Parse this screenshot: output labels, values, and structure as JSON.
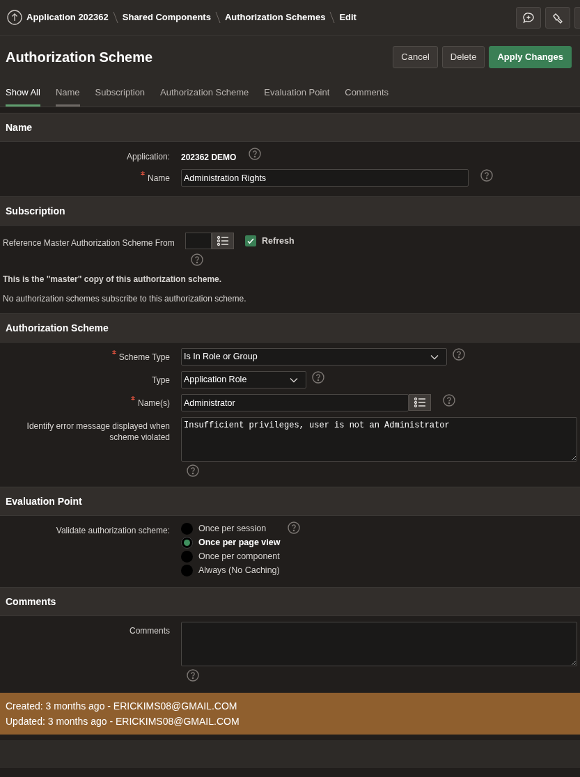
{
  "breadcrumbs": [
    "Application 202362",
    "Shared Components",
    "Authorization Schemes",
    "Edit"
  ],
  "title": "Authorization Scheme",
  "buttons": [
    {
      "label": "Cancel",
      "kind": "default"
    },
    {
      "label": "Delete",
      "kind": "default"
    },
    {
      "label": "Apply Changes",
      "kind": "primary"
    }
  ],
  "tabs": [
    {
      "label": "Show All",
      "selected": true,
      "hovered": false
    },
    {
      "label": "Name",
      "selected": false,
      "hovered": true
    },
    {
      "label": "Subscription",
      "selected": false,
      "hovered": false
    },
    {
      "label": "Authorization Scheme",
      "selected": false,
      "hovered": false
    },
    {
      "label": "Evaluation Point",
      "selected": false,
      "hovered": false
    },
    {
      "label": "Comments",
      "selected": false,
      "hovered": false
    }
  ],
  "sections": [
    {
      "title": "Name",
      "rows": [
        {
          "kind": "display",
          "label": "Application:",
          "value": "202362 DEMO",
          "required": false,
          "help": true
        },
        {
          "kind": "text",
          "label": "Name",
          "value": "Administration Rights",
          "required": true,
          "help": true
        }
      ]
    },
    {
      "title": "Subscription",
      "rows": [
        {
          "kind": "subscription",
          "label": "Reference Master Authorization Scheme From",
          "checkbox": {
            "label": "Refresh",
            "checked": true
          },
          "help": true
        },
        {
          "kind": "note",
          "text": "This is the \"master\" copy of this authorization scheme.",
          "bold": true
        },
        {
          "kind": "note",
          "text": "No authorization schemes subscribe to this authorization scheme.",
          "bold": false
        }
      ]
    },
    {
      "title": "Authorization Scheme",
      "rows": [
        {
          "kind": "select",
          "label": "Scheme Type",
          "value": "Is In Role or Group",
          "required": true,
          "help": true
        },
        {
          "kind": "select",
          "label": "Type",
          "value": "Application Role",
          "required": false,
          "help": true
        },
        {
          "kind": "lov",
          "label": "Name(s)",
          "value": "Administrator",
          "required": true,
          "help": true
        },
        {
          "kind": "textarea",
          "label": "Identify error message displayed when scheme violated",
          "value": "Insufficient privileges, user is not an Administrator",
          "required": false,
          "help": true
        }
      ]
    },
    {
      "title": "Evaluation Point",
      "rows": [
        {
          "kind": "radio",
          "label": "Validate authorization scheme:",
          "help": true,
          "options": [
            {
              "label": "Once per session",
              "selected": false
            },
            {
              "label": "Once per page view",
              "selected": true
            },
            {
              "label": "Once per component",
              "selected": false
            },
            {
              "label": "Always (No Caching)",
              "selected": false
            }
          ]
        }
      ]
    },
    {
      "title": "Comments",
      "rows": [
        {
          "kind": "textarea",
          "label": "Comments",
          "required": false,
          "help": true
        }
      ]
    }
  ],
  "audit": [
    "Created: 3 months ago - ERICKIMS08@GMAIL.COM",
    "Updated: 3 months ago - ERICKIMS08@GMAIL.COM"
  ]
}
